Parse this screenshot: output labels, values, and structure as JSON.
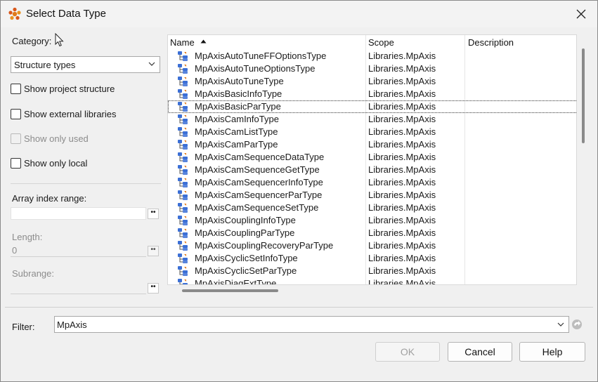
{
  "window": {
    "title": "Select Data Type",
    "close_glyph": "✕"
  },
  "left": {
    "category_label": "Category:",
    "category_value": "Structure types",
    "checkboxes": [
      {
        "label": "Show project structure",
        "checked": false,
        "enabled": true
      },
      {
        "label": "Show external libraries",
        "checked": false,
        "enabled": true
      },
      {
        "label": "Show only used",
        "checked": false,
        "enabled": false
      },
      {
        "label": "Show only local",
        "checked": false,
        "enabled": true
      }
    ],
    "array_index_label": "Array index range:",
    "array_index_value": "",
    "length_label": "Length:",
    "length_value": "0",
    "subrange_label": "Subrange:",
    "subrange_value": "",
    "dots": "••"
  },
  "grid": {
    "columns": {
      "name": "Name",
      "scope": "Scope",
      "description": "Description"
    },
    "sort": "ascending",
    "rows": [
      {
        "name": "MpAxisAutoTuneFFOptionsType",
        "scope": "Libraries.MpAxis",
        "description": ""
      },
      {
        "name": "MpAxisAutoTuneOptionsType",
        "scope": "Libraries.MpAxis",
        "description": ""
      },
      {
        "name": "MpAxisAutoTuneType",
        "scope": "Libraries.MpAxis",
        "description": ""
      },
      {
        "name": "MpAxisBasicInfoType",
        "scope": "Libraries.MpAxis",
        "description": ""
      },
      {
        "name": "MpAxisBasicParType",
        "scope": "Libraries.MpAxis",
        "description": "",
        "selected": true
      },
      {
        "name": "MpAxisCamInfoType",
        "scope": "Libraries.MpAxis",
        "description": ""
      },
      {
        "name": "MpAxisCamListType",
        "scope": "Libraries.MpAxis",
        "description": ""
      },
      {
        "name": "MpAxisCamParType",
        "scope": "Libraries.MpAxis",
        "description": ""
      },
      {
        "name": "MpAxisCamSequenceDataType",
        "scope": "Libraries.MpAxis",
        "description": ""
      },
      {
        "name": "MpAxisCamSequenceGetType",
        "scope": "Libraries.MpAxis",
        "description": ""
      },
      {
        "name": "MpAxisCamSequencerInfoType",
        "scope": "Libraries.MpAxis",
        "description": ""
      },
      {
        "name": "MpAxisCamSequencerParType",
        "scope": "Libraries.MpAxis",
        "description": ""
      },
      {
        "name": "MpAxisCamSequenceSetType",
        "scope": "Libraries.MpAxis",
        "description": ""
      },
      {
        "name": "MpAxisCouplingInfoType",
        "scope": "Libraries.MpAxis",
        "description": ""
      },
      {
        "name": "MpAxisCouplingParType",
        "scope": "Libraries.MpAxis",
        "description": ""
      },
      {
        "name": "MpAxisCouplingRecoveryParType",
        "scope": "Libraries.MpAxis",
        "description": ""
      },
      {
        "name": "MpAxisCyclicSetInfoType",
        "scope": "Libraries.MpAxis",
        "description": ""
      },
      {
        "name": "MpAxisCyclicSetParType",
        "scope": "Libraries.MpAxis",
        "description": ""
      },
      {
        "name": "MpAxisDiagExtType",
        "scope": "Libraries.MpAxis",
        "description": ""
      }
    ],
    "row_icon": "structure-type-icon"
  },
  "filter": {
    "label": "Filter:",
    "value": "MpAxis"
  },
  "buttons": {
    "ok": "OK",
    "ok_enabled": false,
    "cancel": "Cancel",
    "help": "Help"
  },
  "colors": {
    "icon_blue": "#3b6fd6",
    "icon_orange": "#e07a1a"
  }
}
